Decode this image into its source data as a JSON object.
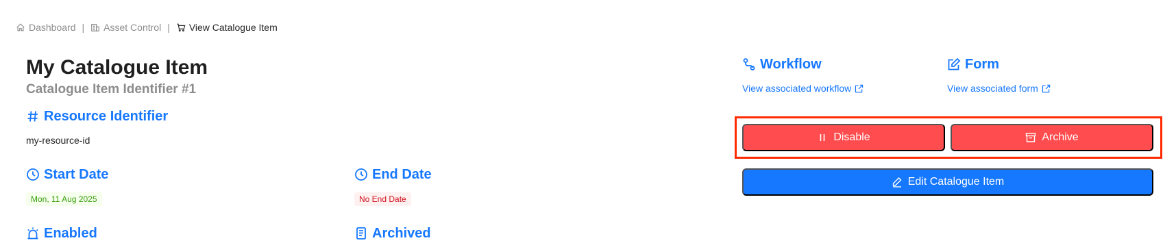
{
  "breadcrumb": {
    "items": [
      {
        "label": "Dashboard",
        "icon": "home-icon"
      },
      {
        "label": "Asset Control",
        "icon": "building-icon"
      },
      {
        "label": "View Catalogue Item",
        "icon": "cart-icon"
      }
    ],
    "separator": "|"
  },
  "header": {
    "title": "My Catalogue Item",
    "subtitle": "Catalogue Item Identifier #1"
  },
  "resource": {
    "title": "Resource Identifier",
    "value": "my-resource-id"
  },
  "start_date": {
    "title": "Start Date",
    "value": "Mon, 11 Aug 2025"
  },
  "end_date": {
    "title": "End Date",
    "value": "No End Date"
  },
  "enabled": {
    "title": "Enabled"
  },
  "archived": {
    "title": "Archived"
  },
  "workflow": {
    "title": "Workflow",
    "link": "View associated workflow"
  },
  "form": {
    "title": "Form",
    "link": "View associated form"
  },
  "actions": {
    "disable_label": "Disable",
    "archive_label": "Archive",
    "edit_label": "Edit Catalogue Item"
  },
  "colors": {
    "primary": "#1677ff",
    "danger": "#ff4d4f",
    "highlight": "#ff2a00",
    "success_tag_text": "#389e0d",
    "error_tag_text": "#cf1322"
  }
}
